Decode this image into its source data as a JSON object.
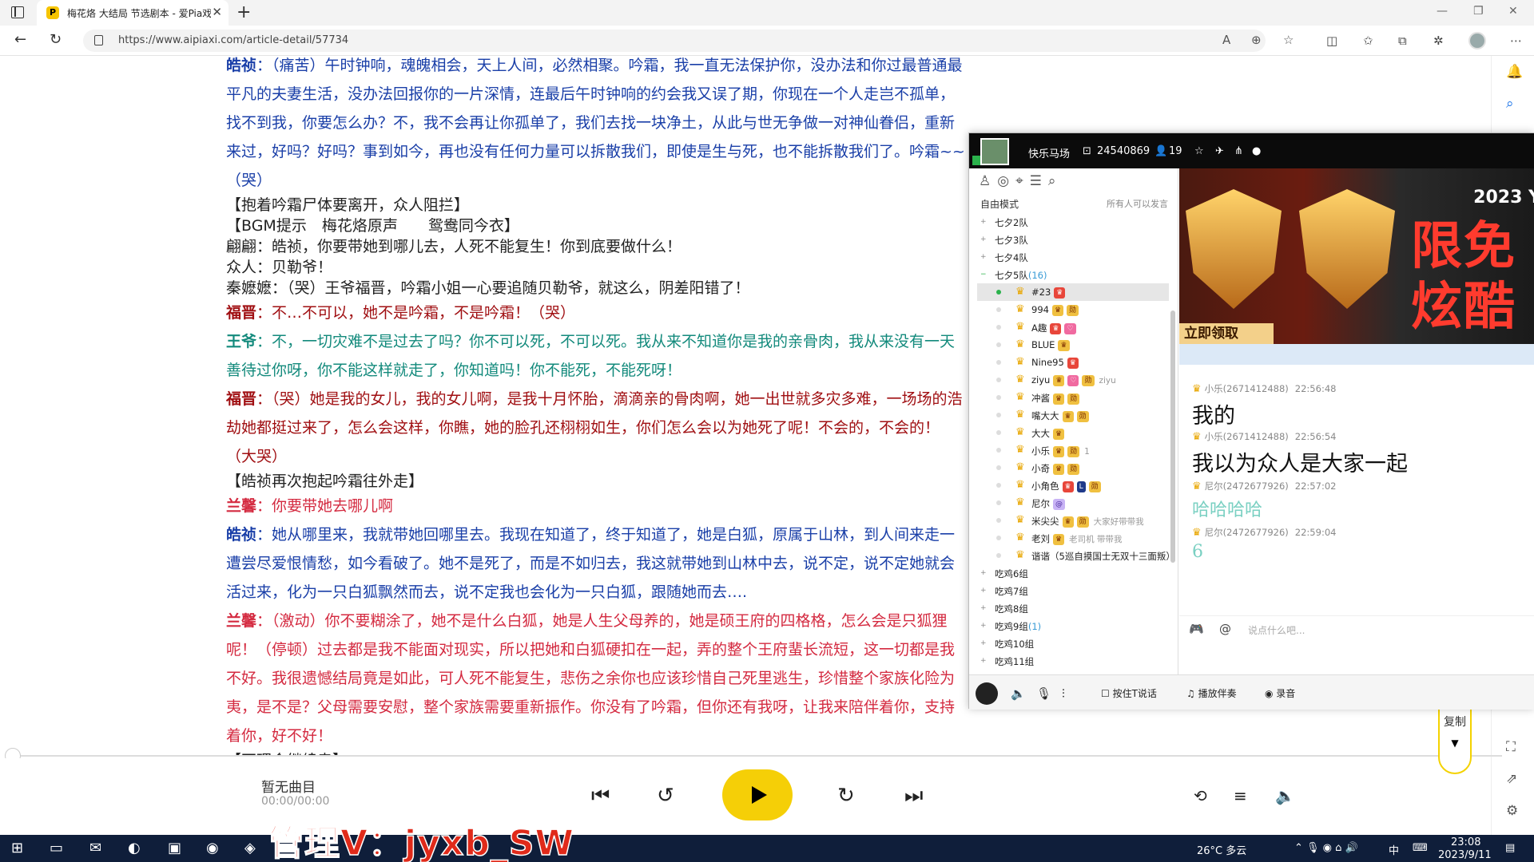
{
  "browser": {
    "tab_title": "梅花烙 大结局 节选剧本 - 爱Pia戏",
    "tab_favicon_text": "P",
    "url": "https://www.aipiaxi.com/article-detail/57734"
  },
  "article": {
    "paragraphs": [
      {
        "speaker": "皓祯",
        "sep": "：",
        "text": "（痛苦）午时钟响，魂魄相会，天上人间，必然相聚。吟霜，我一直无法保护你，没办法和你过最普通最平凡的夫妻生活，没办法回报你的一片深情，连最后午时钟响的约会我又误了期，你现在一个人走岂不孤单，找不到我，你要怎么办？不，我不会再让你孤单了，我们去找一块净土，从此与世无争做一对神仙眷侣，重新来过，好吗？好吗？事到如今，再也没有任何力量可以拆散我们，即使是生与死，也不能拆散我们了。吟霜~~（哭）",
        "cls": "blue"
      },
      {
        "speaker": "",
        "sep": "",
        "text": "【抱着吟霜尸体要离开，众人阻拦】",
        "cls": "dark",
        "small": true
      },
      {
        "speaker": "",
        "sep": "",
        "text": "【BGM提示　梅花烙原声　　鸳鸯同今衣】",
        "cls": "dark",
        "small": true
      },
      {
        "speaker": "",
        "sep": "",
        "text": "翩翩：皓祯，你要带她到哪儿去，人死不能复生！你到底要做什么！",
        "cls": "dark",
        "small": true
      },
      {
        "speaker": "",
        "sep": "",
        "text": "众人：贝勒爷！",
        "cls": "dark",
        "small": true
      },
      {
        "speaker": "",
        "sep": "",
        "text": "秦嬷嬷：（哭）王爷福晋，吟霜小姐一心要追随贝勒爷，就这么，阴差阳错了！",
        "cls": "dark",
        "small": true
      },
      {
        "speaker": "福晋",
        "sep": "：",
        "text": "不…不可以，她不是吟霜，不是吟霜！（哭）",
        "cls": "red"
      },
      {
        "speaker": "王爷",
        "sep": "：",
        "text": "不，一切灾难不是过去了吗？你不可以死，不可以死。我从来不知道你是我的亲骨肉，我从来没有一天善待过你呀，你不能这样就走了，你知道吗！你不能死，不能死呀！",
        "cls": "teal"
      },
      {
        "speaker": "福晋",
        "sep": "：",
        "text": "（哭）她是我的女儿，我的女儿啊，是我十月怀胎，滴滴亲的骨肉啊，她一出世就多灾多难，一场场的浩劫她都挺过来了，怎么会这样，你瞧，她的脸孔还栩栩如生，你们怎么会以为她死了呢！不会的，不会的！（大哭）",
        "cls": "red"
      },
      {
        "speaker": "",
        "sep": "",
        "text": "【皓祯再次抱起吟霜往外走】",
        "cls": "dark",
        "small": true
      },
      {
        "speaker": "兰馨",
        "sep": "：",
        "text": "你要带她去哪儿啊",
        "cls": "pink"
      },
      {
        "speaker": "皓祯",
        "sep": "：",
        "text": "她从哪里来，我就带她回哪里去。我现在知道了，终于知道了，她是白狐，原属于山林，到人间来走一遭尝尽爱恨情愁，如今看破了。她不是死了，而是不如归去，我这就带她到山林中去，说不定，说不定她就会活过来，化为一只白狐飘然而去，说不定我也会化为一只白狐，跟随她而去….",
        "cls": "blue"
      },
      {
        "speaker": "兰馨",
        "sep": "：",
        "text": "（激动）你不要糊涂了，她不是什么白狐，她是人生父母养的，她是硕王府的四格格，怎么会是只狐狸呢！（停顿）过去都是我不能面对现实，所以把她和白狐硬扣在一起，弄的整个王府蜚长流短，这一切都是我不好。我很遗憾结局竟是如此，可人死不能复生，悲伤之余你也应该珍惜自己死里逃生，珍惜整个家族化险为夷，是不是？父母需要安慰，整个家族需要重新振作。你没有了吟霜，但你还有我呀，让我来陪伴着你，支持着你，好不好！",
        "cls": "pink"
      },
      {
        "speaker": "",
        "sep": "",
        "text": "【不理会继续走】",
        "cls": "dark",
        "small": true
      }
    ]
  },
  "player": {
    "song": "暂无曲目",
    "time": "00:00/00:00"
  },
  "copy_label": "复制",
  "watermark": "管理V：jyxb_SW",
  "yy": {
    "channel_name": "快乐马场",
    "channel_id": "24540869",
    "online": "19",
    "mode": "自由模式",
    "mode_right": "所有人可以发言",
    "groups_top": [
      {
        "name": "七夕2队"
      },
      {
        "name": "七夕3队"
      },
      {
        "name": "七夕4队"
      }
    ],
    "open_group": {
      "name": "七夕5队",
      "count": "(16)"
    },
    "members": [
      {
        "name": "#23",
        "badges": [
          [
            "r",
            "♛"
          ]
        ],
        "note": "",
        "sel": true
      },
      {
        "name": "994",
        "badges": [
          [
            "y",
            "♛"
          ],
          [
            "y",
            "勋"
          ]
        ],
        "note": ""
      },
      {
        "name": "A趣",
        "badges": [
          [
            "r",
            "♛"
          ],
          [
            "p",
            "♡"
          ]
        ],
        "note": ""
      },
      {
        "name": "BLUE",
        "badges": [
          [
            "y",
            "♛"
          ]
        ],
        "note": ""
      },
      {
        "name": "Nine95",
        "badges": [
          [
            "r",
            "♛"
          ]
        ],
        "note": ""
      },
      {
        "name": "ziyu",
        "badges": [
          [
            "y",
            "♛"
          ],
          [
            "p",
            "♡"
          ],
          [
            "y",
            "勋"
          ]
        ],
        "note": "ziyu"
      },
      {
        "name": "冲酱",
        "badges": [
          [
            "y",
            "♛"
          ],
          [
            "y",
            "勋"
          ]
        ],
        "note": ""
      },
      {
        "name": "嘴大大",
        "badges": [
          [
            "y",
            "♛"
          ],
          [
            "y",
            "勋"
          ]
        ],
        "note": ""
      },
      {
        "name": "大大",
        "badges": [
          [
            "y",
            "♛"
          ]
        ],
        "note": ""
      },
      {
        "name": "小乐",
        "badges": [
          [
            "y",
            "♛"
          ],
          [
            "y",
            "勋"
          ]
        ],
        "note": "1"
      },
      {
        "name": "小奇",
        "badges": [
          [
            "y",
            "♛"
          ],
          [
            "y",
            "勋"
          ]
        ],
        "note": ""
      },
      {
        "name": "小角色",
        "badges": [
          [
            "r",
            "♛"
          ],
          [
            "b",
            "L"
          ],
          [
            "y",
            "勋"
          ]
        ],
        "note": ""
      },
      {
        "name": "尼尔",
        "badges": [
          [
            "v",
            "@"
          ]
        ],
        "note": ""
      },
      {
        "name": "米尖尖",
        "badges": [
          [
            "y",
            "♛"
          ],
          [
            "y",
            "勋"
          ]
        ],
        "note": "大家好带带我"
      },
      {
        "name": "老刘",
        "badges": [
          [
            "y",
            "♛"
          ]
        ],
        "note": "老司机 带带我"
      },
      {
        "name": "谐谐（5巡自摸国士无双十三面叛）",
        "badges": [],
        "note": ""
      }
    ],
    "groups_bottom": [
      {
        "name": "吃鸡6组",
        "count": ""
      },
      {
        "name": "吃鸡7组",
        "count": ""
      },
      {
        "name": "吃鸡8组",
        "count": ""
      },
      {
        "name": "吃鸡9组",
        "count": "(1)"
      },
      {
        "name": "吃鸡10组",
        "count": ""
      },
      {
        "name": "吃鸡11组",
        "count": ""
      }
    ],
    "banner": {
      "year": "2023 Y",
      "big": "限免\n炫酷",
      "claim": "立即领取"
    },
    "messages": [
      {
        "who": "小乐(2671412488)",
        "time": "22:56:48",
        "body": "我的",
        "green": false
      },
      {
        "who": "小乐(2671412488)",
        "time": "22:56:54",
        "body": "我以为众人是大家一起",
        "green": false
      },
      {
        "who": "尼尔(2472677926)",
        "time": "22:57:02",
        "body": "哈哈哈哈",
        "green": true
      },
      {
        "who": "尼尔(2472677926)",
        "time": "22:59:04",
        "body": "6",
        "green": true
      }
    ],
    "input_placeholder": "说点什么吧...",
    "bottom": {
      "ptt": "按住T说话",
      "accomp": "播放伴奏",
      "record": "录音"
    }
  },
  "taskbar": {
    "weather": "26°C 多云",
    "ime": "中",
    "time": "23:08",
    "date": "2023/9/11"
  }
}
